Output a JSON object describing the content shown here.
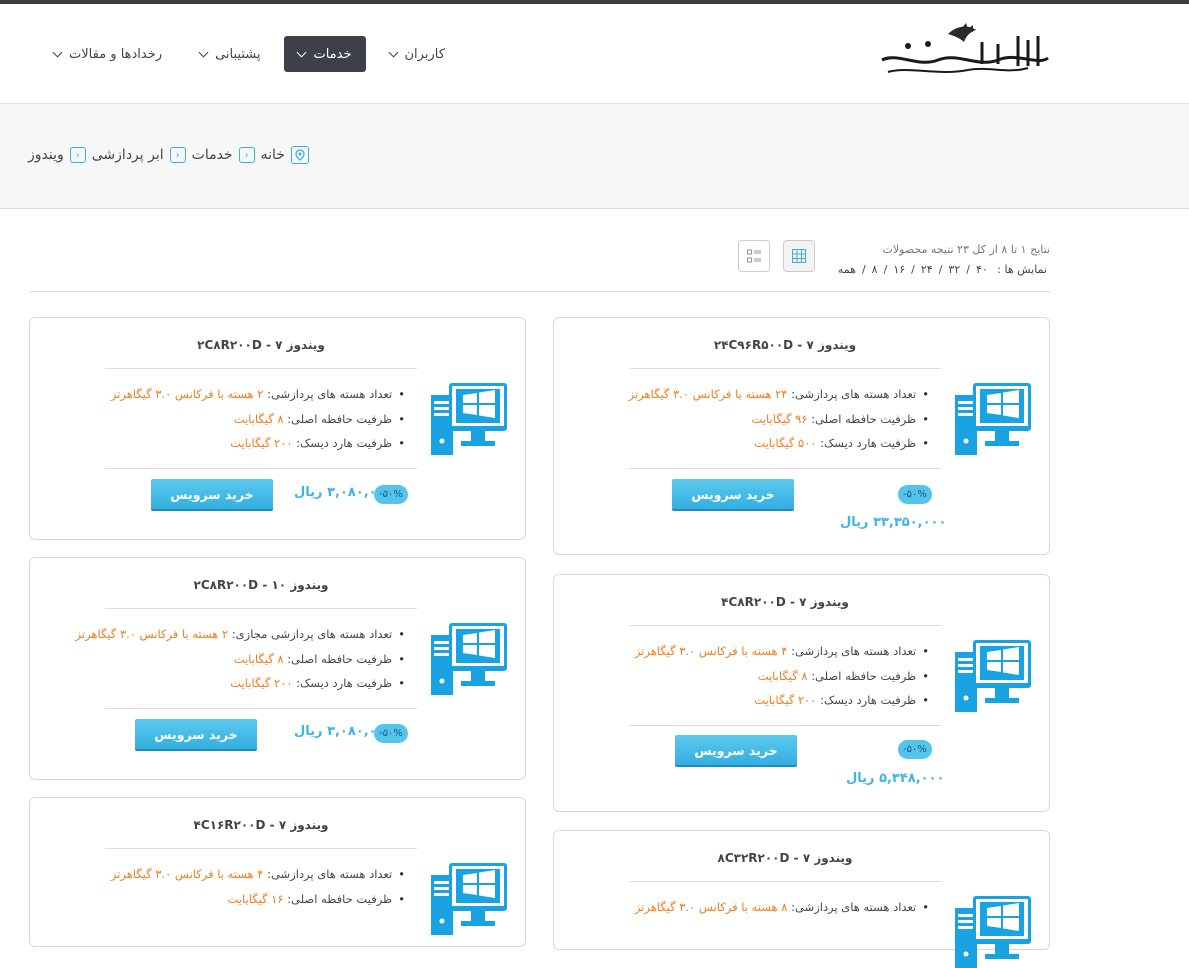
{
  "header": {
    "logo_text": "ابر رایانه ملی سیمرغ",
    "nav": [
      {
        "label": "کاربران"
      },
      {
        "label": "خدمات"
      },
      {
        "label": "پشتیبانی"
      },
      {
        "label": "رخدادها و مقالات"
      }
    ]
  },
  "breadcrumb": [
    "خانه",
    "خدمات",
    "ابر پردازشی",
    "ویندوز"
  ],
  "results": {
    "summary": "نتایج ۱ تا ۸ از کل ۲۳ نتیجه محصولات",
    "per_page_label": "نمایش ها :",
    "per_page_options": [
      "۸",
      "/",
      "۱۶",
      "/",
      "۲۴",
      "/",
      "۳۲",
      "/",
      "۴۰",
      "/",
      "همه"
    ]
  },
  "products": [
    {
      "title": "ویندوز ۷ - ۲۴C۹۶R۵۰۰D",
      "specs": [
        {
          "label": "تعداد هسته های پردازشی:",
          "value": "۲۴ هسته با فرکانس ۳.۰ گیگاهرتز"
        },
        {
          "label": "ظرفیت حافظه اصلی:",
          "value": "۹۶ گیگابایت"
        },
        {
          "label": "ظرفیت هارد دیسک:",
          "value": "۵۰۰ گیگابایت"
        }
      ],
      "discount": "-۵۰%",
      "price": "۳۳,۳۵۰,۰۰۰ ریال",
      "buy_label": "خرید سرویس"
    },
    {
      "title": "ویندوز ۷ - ۲C۸R۲۰۰D",
      "specs": [
        {
          "label": "تعداد هسته های پردازشی:",
          "value": "۲ هسته با فرکانس ۳.۰ گیگاهرتز"
        },
        {
          "label": "ظرفیت حافظه اصلی:",
          "value": "۸ گیگابایت"
        },
        {
          "label": "ظرفیت هارد دیسک:",
          "value": "۲۰۰ گیگابایت"
        }
      ],
      "discount": "-۵۰%",
      "price": "۳,۰۸۰,۰۰۰ ریال",
      "buy_label": "خرید سرویس"
    },
    {
      "title": "ویندوز ۷ - ۴C۸R۲۰۰D",
      "specs": [
        {
          "label": "تعداد هسته های پردازشی:",
          "value": "۴ هسته با فرکانس ۳.۰ گیگاهرتز"
        },
        {
          "label": "ظرفیت حافظه اصلی:",
          "value": "۸ گیگابایت"
        },
        {
          "label": "ظرفیت هارد دیسک:",
          "value": "۲۰۰ گیگابایت"
        }
      ],
      "discount": "-۵۰%",
      "price": "۵,۳۴۸,۰۰۰ ریال",
      "buy_label": "خرید سرویس"
    },
    {
      "title": "ویندوز ۱۰ - ۲C۸R۲۰۰D",
      "specs": [
        {
          "label": "تعداد هسته های پردازشی مجازی:",
          "value": "۲ هسته با فرکانس ۳.۰ گیگاهرتز"
        },
        {
          "label": "ظرفیت حافظه اصلی:",
          "value": "۸ گیگابایت"
        },
        {
          "label": "ظرفیت هارد دیسک:",
          "value": "۲۰۰ گیگابایت"
        }
      ],
      "discount": "-۵۰%",
      "price": "۳,۰۸۰,۰۰۰ ریال",
      "buy_label": "خرید سرویس"
    },
    {
      "title": "ویندوز ۷ - ۸C۳۲R۲۰۰D",
      "specs": [
        {
          "label": "تعداد هسته های پردازشی:",
          "value": "۸ هسته با فرکانس ۳.۰ گیگاهرتز"
        }
      ]
    },
    {
      "title": "ویندوز ۷ - ۴C۱۶R۲۰۰D",
      "specs": [
        {
          "label": "تعداد هسته های پردازشی:",
          "value": "۴ هسته با فرکانس ۳.۰ گیگاهرتز"
        },
        {
          "label": "ظرفیت حافظه اصلی:",
          "value": "۱۶ گیگابایت"
        }
      ]
    }
  ],
  "colors": {
    "accent": "#3ab0e2",
    "spec_value": "#f47a20",
    "nav_active": "#3e4049"
  },
  "icons": {
    "product": "windows-pc-icon",
    "location": "map-pin-icon",
    "grid": "grid-view-icon",
    "list": "list-view-icon"
  }
}
